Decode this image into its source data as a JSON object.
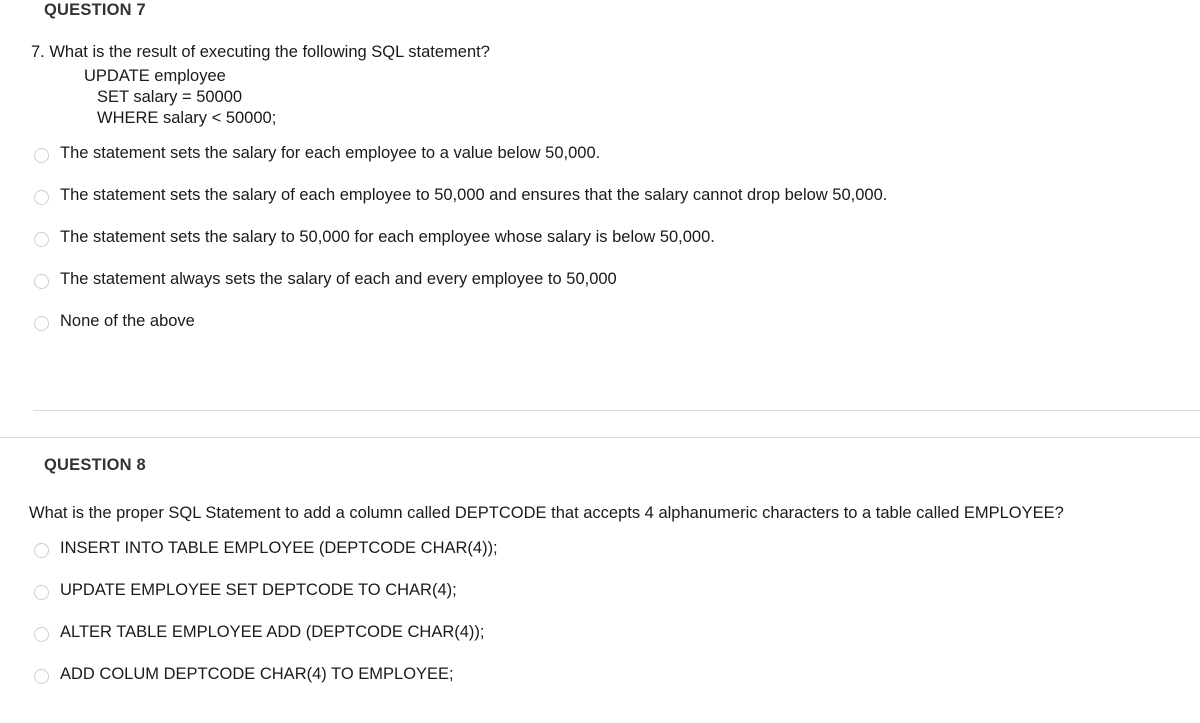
{
  "questions": [
    {
      "header": "QUESTION 7",
      "prompt": "7. What is the result of executing the following SQL statement?",
      "sql": [
        "UPDATE employee",
        "SET salary = 50000",
        "WHERE salary < 50000;"
      ],
      "options": [
        "The statement sets the salary for each employee to a value below 50,000.",
        "The statement sets the salary of each employee to 50,000 and ensures that the salary cannot drop below 50,000.",
        "The statement sets the salary to 50,000 for each employee whose salary is below 50,000.",
        "The statement always sets the salary of each and every employee to 50,000",
        "None of the above"
      ]
    },
    {
      "header": "QUESTION 8",
      "prompt": "What is the proper SQL Statement to add a column called DEPTCODE that accepts 4 alphanumeric characters to a table called EMPLOYEE?",
      "sql": [],
      "options": [
        "INSERT INTO TABLE EMPLOYEE (DEPTCODE CHAR(4));",
        "UPDATE EMPLOYEE SET DEPTCODE TO CHAR(4);",
        "ALTER TABLE EMPLOYEE ADD (DEPTCODE CHAR(4));",
        "ADD COLUM DEPTCODE CHAR(4) TO EMPLOYEE;"
      ]
    }
  ],
  "colors": {
    "heading": "#333333",
    "text": "#1a1a1a",
    "divider": "#dcdcdc",
    "radio_border": "#cfcfcf",
    "background": "#ffffff"
  }
}
